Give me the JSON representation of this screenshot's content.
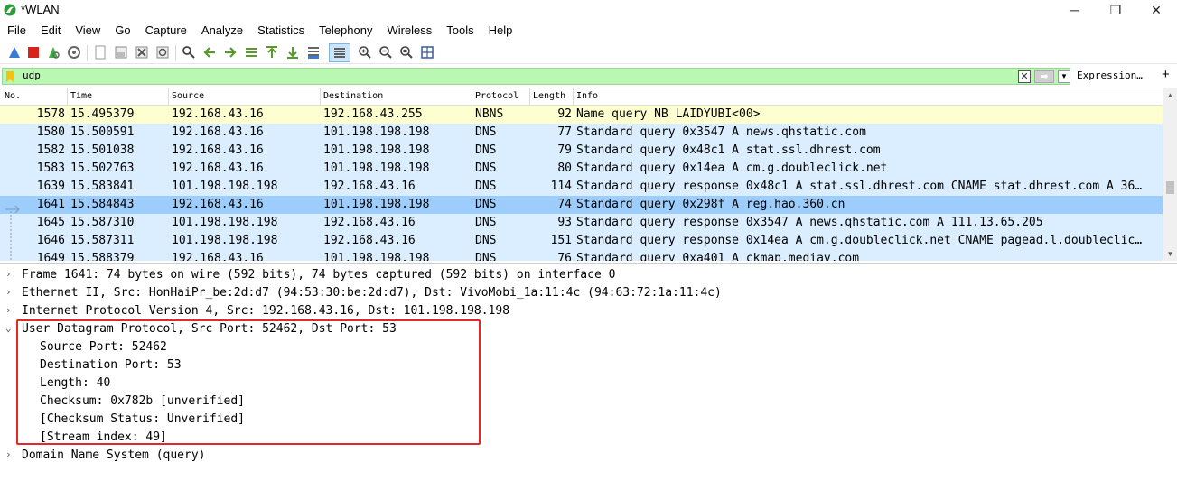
{
  "window": {
    "title": "*WLAN",
    "minimize": "─",
    "maximize": "❐",
    "close": "✕"
  },
  "menu": [
    "File",
    "Edit",
    "View",
    "Go",
    "Capture",
    "Analyze",
    "Statistics",
    "Telephony",
    "Wireless",
    "Tools",
    "Help"
  ],
  "toolbar": {
    "icons": [
      "shark-fin-icon",
      "stop-capture-icon",
      "restart-capture-icon",
      "capture-options-icon",
      "open-file-icon",
      "save-file-icon",
      "close-file-icon",
      "reload-icon",
      "find-packet-icon",
      "go-back-icon",
      "go-forward-icon",
      "go-to-packet-icon",
      "first-packet-icon",
      "last-packet-icon",
      "autoscroll-icon",
      "colorize-icon",
      "zoom-in-icon",
      "zoom-out-icon",
      "normal-size-icon",
      "resize-columns-icon"
    ]
  },
  "filter": {
    "value": "udp",
    "expression_label": "Expression…",
    "add_label": "+"
  },
  "packet_list": {
    "columns": [
      "No.",
      "Time",
      "Source",
      "Destination",
      "Protocol",
      "Length",
      "Info"
    ],
    "rows": [
      {
        "no": "1578",
        "time": "15.495379",
        "src": "192.168.43.16",
        "dst": "192.168.43.255",
        "proto": "NBNS",
        "len": "92",
        "info": "Name query NB LAIDYUBI<00>",
        "color": "#feffd0"
      },
      {
        "no": "1580",
        "time": "15.500591",
        "src": "192.168.43.16",
        "dst": "101.198.198.198",
        "proto": "DNS",
        "len": "77",
        "info": "Standard query 0x3547 A news.qhstatic.com",
        "color": "#daeeff"
      },
      {
        "no": "1582",
        "time": "15.501038",
        "src": "192.168.43.16",
        "dst": "101.198.198.198",
        "proto": "DNS",
        "len": "79",
        "info": "Standard query 0x48c1 A stat.ssl.dhrest.com",
        "color": "#daeeff"
      },
      {
        "no": "1583",
        "time": "15.502763",
        "src": "192.168.43.16",
        "dst": "101.198.198.198",
        "proto": "DNS",
        "len": "80",
        "info": "Standard query 0x14ea A cm.g.doubleclick.net",
        "color": "#daeeff"
      },
      {
        "no": "1639",
        "time": "15.583841",
        "src": "101.198.198.198",
        "dst": "192.168.43.16",
        "proto": "DNS",
        "len": "114",
        "info": "Standard query response 0x48c1 A stat.ssl.dhrest.com CNAME stat.dhrest.com A 36…",
        "color": "#daeeff"
      },
      {
        "no": "1641",
        "time": "15.584843",
        "src": "192.168.43.16",
        "dst": "101.198.198.198",
        "proto": "DNS",
        "len": "74",
        "info": "Standard query 0x298f A reg.hao.360.cn",
        "color": "#9dcdfc"
      },
      {
        "no": "1645",
        "time": "15.587310",
        "src": "101.198.198.198",
        "dst": "192.168.43.16",
        "proto": "DNS",
        "len": "93",
        "info": "Standard query response 0x3547 A news.qhstatic.com A 111.13.65.205",
        "color": "#daeeff"
      },
      {
        "no": "1646",
        "time": "15.587311",
        "src": "101.198.198.198",
        "dst": "192.168.43.16",
        "proto": "DNS",
        "len": "151",
        "info": "Standard query response 0x14ea A cm.g.doubleclick.net CNAME pagead.l.doubleclic…",
        "color": "#daeeff"
      },
      {
        "no": "1649",
        "time": "15.588379",
        "src": "192.168.43.16",
        "dst": "101.198.198.198",
        "proto": "DNS",
        "len": "76",
        "info": "Standard query 0xa401 A ckmap.mediav.com",
        "color": "#daeeff"
      }
    ]
  },
  "details": [
    {
      "text": "Frame 1641: 74 bytes on wire (592 bits), 74 bytes captured (592 bits) on interface 0",
      "indent": 0,
      "arrow": "›"
    },
    {
      "text": "Ethernet II, Src: HonHaiPr_be:2d:d7 (94:53:30:be:2d:d7), Dst: VivoMobi_1a:11:4c (94:63:72:1a:11:4c)",
      "indent": 0,
      "arrow": "›"
    },
    {
      "text": "Internet Protocol Version 4, Src: 192.168.43.16, Dst: 101.198.198.198",
      "indent": 0,
      "arrow": "›"
    },
    {
      "text": "User Datagram Protocol, Src Port: 52462, Dst Port: 53",
      "indent": 0,
      "arrow": "⌄"
    },
    {
      "text": "Source Port: 52462",
      "indent": 1,
      "arrow": ""
    },
    {
      "text": "Destination Port: 53",
      "indent": 1,
      "arrow": ""
    },
    {
      "text": "Length: 40",
      "indent": 1,
      "arrow": ""
    },
    {
      "text": "Checksum: 0x782b [unverified]",
      "indent": 1,
      "arrow": ""
    },
    {
      "text": "[Checksum Status: Unverified]",
      "indent": 1,
      "arrow": ""
    },
    {
      "text": "[Stream index: 49]",
      "indent": 1,
      "arrow": ""
    },
    {
      "text": "Domain Name System (query)",
      "indent": 0,
      "arrow": "›"
    }
  ],
  "colors": {
    "filter_valid": "#b9f7b3",
    "selected_row": "#9dcdfc",
    "dns_row": "#daeeff",
    "nbns_row": "#feffd0",
    "annotation": "#e5262a"
  }
}
